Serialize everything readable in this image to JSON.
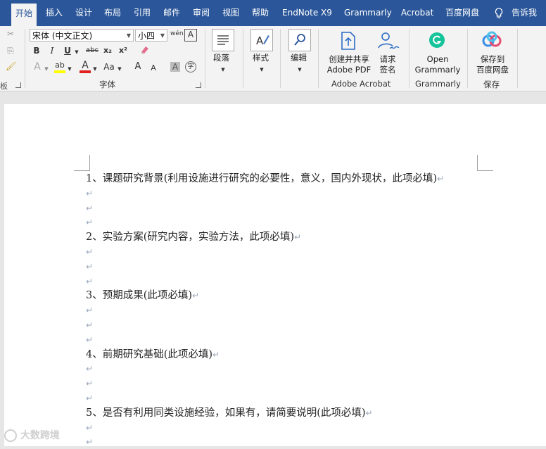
{
  "tabs": [
    "开始",
    "插入",
    "设计",
    "布局",
    "引用",
    "邮件",
    "审阅",
    "视图",
    "帮助",
    "EndNote X9",
    "Grammarly",
    "Acrobat",
    "百度网盘",
    "告诉我"
  ],
  "font": {
    "name": "宋体 (中文正文)",
    "size": "小四"
  },
  "groups": {
    "font": "字体",
    "adobe": "Adobe Acrobat",
    "grammarly": "Grammarly",
    "save": "保存"
  },
  "buttons": {
    "paragraph": "段落",
    "styles": "样式",
    "editing": "编辑",
    "create_pdf_1": "创建并共享",
    "create_pdf_2": "Adobe PDF",
    "sign_1": "请求",
    "sign_2": "签名",
    "grammarly_1": "Open",
    "grammarly_2": "Grammarly",
    "baidu_1": "保存到",
    "baidu_2": "百度网盘"
  },
  "format": {
    "bold": "B",
    "italic": "I",
    "underline": "U",
    "strike": "abc",
    "sub": "x₂",
    "sup": "x²",
    "case": "Aa",
    "grow": "A",
    "shrink": "A",
    "clear": "A",
    "phonetic": "wén",
    "charbox": "A",
    "encircle": "字"
  },
  "document": {
    "lines": [
      "1、课题研究背景(利用设施进行研究的必要性，意义，国内外现状，此项必填)",
      "",
      "",
      "",
      "2、实验方案(研究内容，实验方法，此项必填)",
      "",
      "",
      "",
      "3、预期成果(此项必填)",
      "",
      "",
      "",
      "4、前期研究基础(此项必填)",
      "",
      "",
      "",
      "5、是否有利用同类设施经验，如果有，请简要说明(此项必填)",
      "",
      ""
    ],
    "paragraph_mark": "↵"
  },
  "watermark": "大数跨境"
}
